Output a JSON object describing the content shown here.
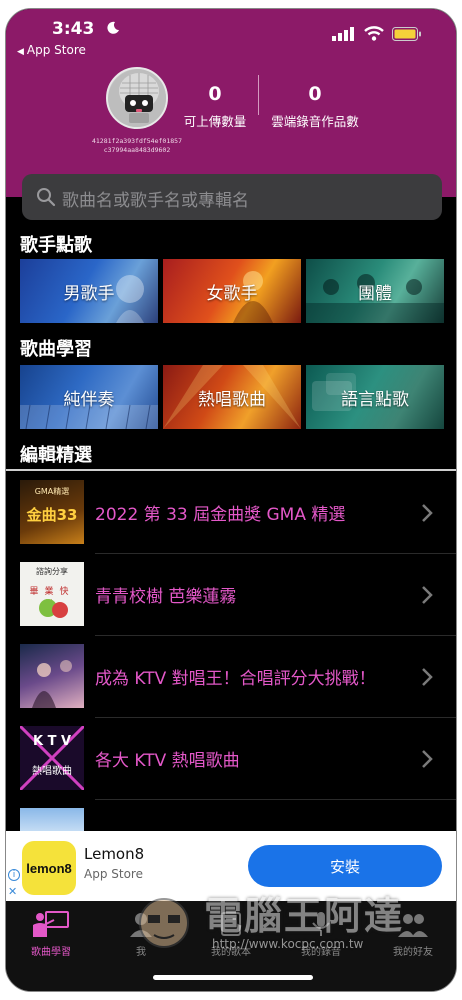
{
  "status": {
    "time": "3:43",
    "back_label": "App Store"
  },
  "profile": {
    "user_id_line1": "41281f2a393fdf54ef01857",
    "user_id_line2": "c37994aa8483d9602",
    "stats": [
      {
        "value": "0",
        "label": "可上傳數量"
      },
      {
        "value": "0",
        "label": "雲端錄音作品數"
      }
    ]
  },
  "search": {
    "placeholder": "歌曲名或歌手名或專輯名"
  },
  "sections": {
    "singers": {
      "title": "歌手點歌",
      "tiles": [
        "男歌手",
        "女歌手",
        "團體"
      ]
    },
    "learning": {
      "title": "歌曲學習",
      "tiles": [
        "純伴奏",
        "熱唱歌曲",
        "語言點歌"
      ]
    },
    "editor": {
      "title": "編輯精選"
    }
  },
  "playlists": [
    {
      "title": "2022 第 33 屆金曲獎 GMA 精選",
      "thumb_text": "GMA精選",
      "thumb_big": "金曲33"
    },
    {
      "title": "青青校樹 芭樂蓮霧",
      "thumb_text": "諮詢分享",
      "thumb_big": "畢業快樂"
    },
    {
      "title": "成為 KTV 對唱王！合唱評分大挑戰！",
      "thumb_text": "",
      "thumb_big": ""
    },
    {
      "title": "各大 KTV 熱唱歌曲",
      "thumb_text": "K T V",
      "thumb_big": "熱唱歌曲"
    }
  ],
  "ad": {
    "app_name": "Lemon8",
    "store": "App Store",
    "install": "安裝",
    "logo_text": "lemon8"
  },
  "tabs": [
    {
      "label": "歌曲學習"
    },
    {
      "label": "我"
    },
    {
      "label": "我的歌本"
    },
    {
      "label": "我的錄音"
    },
    {
      "label": "我的好友"
    }
  ],
  "watermark": {
    "text": "電腦王阿達",
    "url": "http://www.kocpc.com.tw"
  },
  "colors": {
    "header": "#8c1a68",
    "accent_pink": "#e358c8",
    "install_blue": "#1a73e8"
  }
}
